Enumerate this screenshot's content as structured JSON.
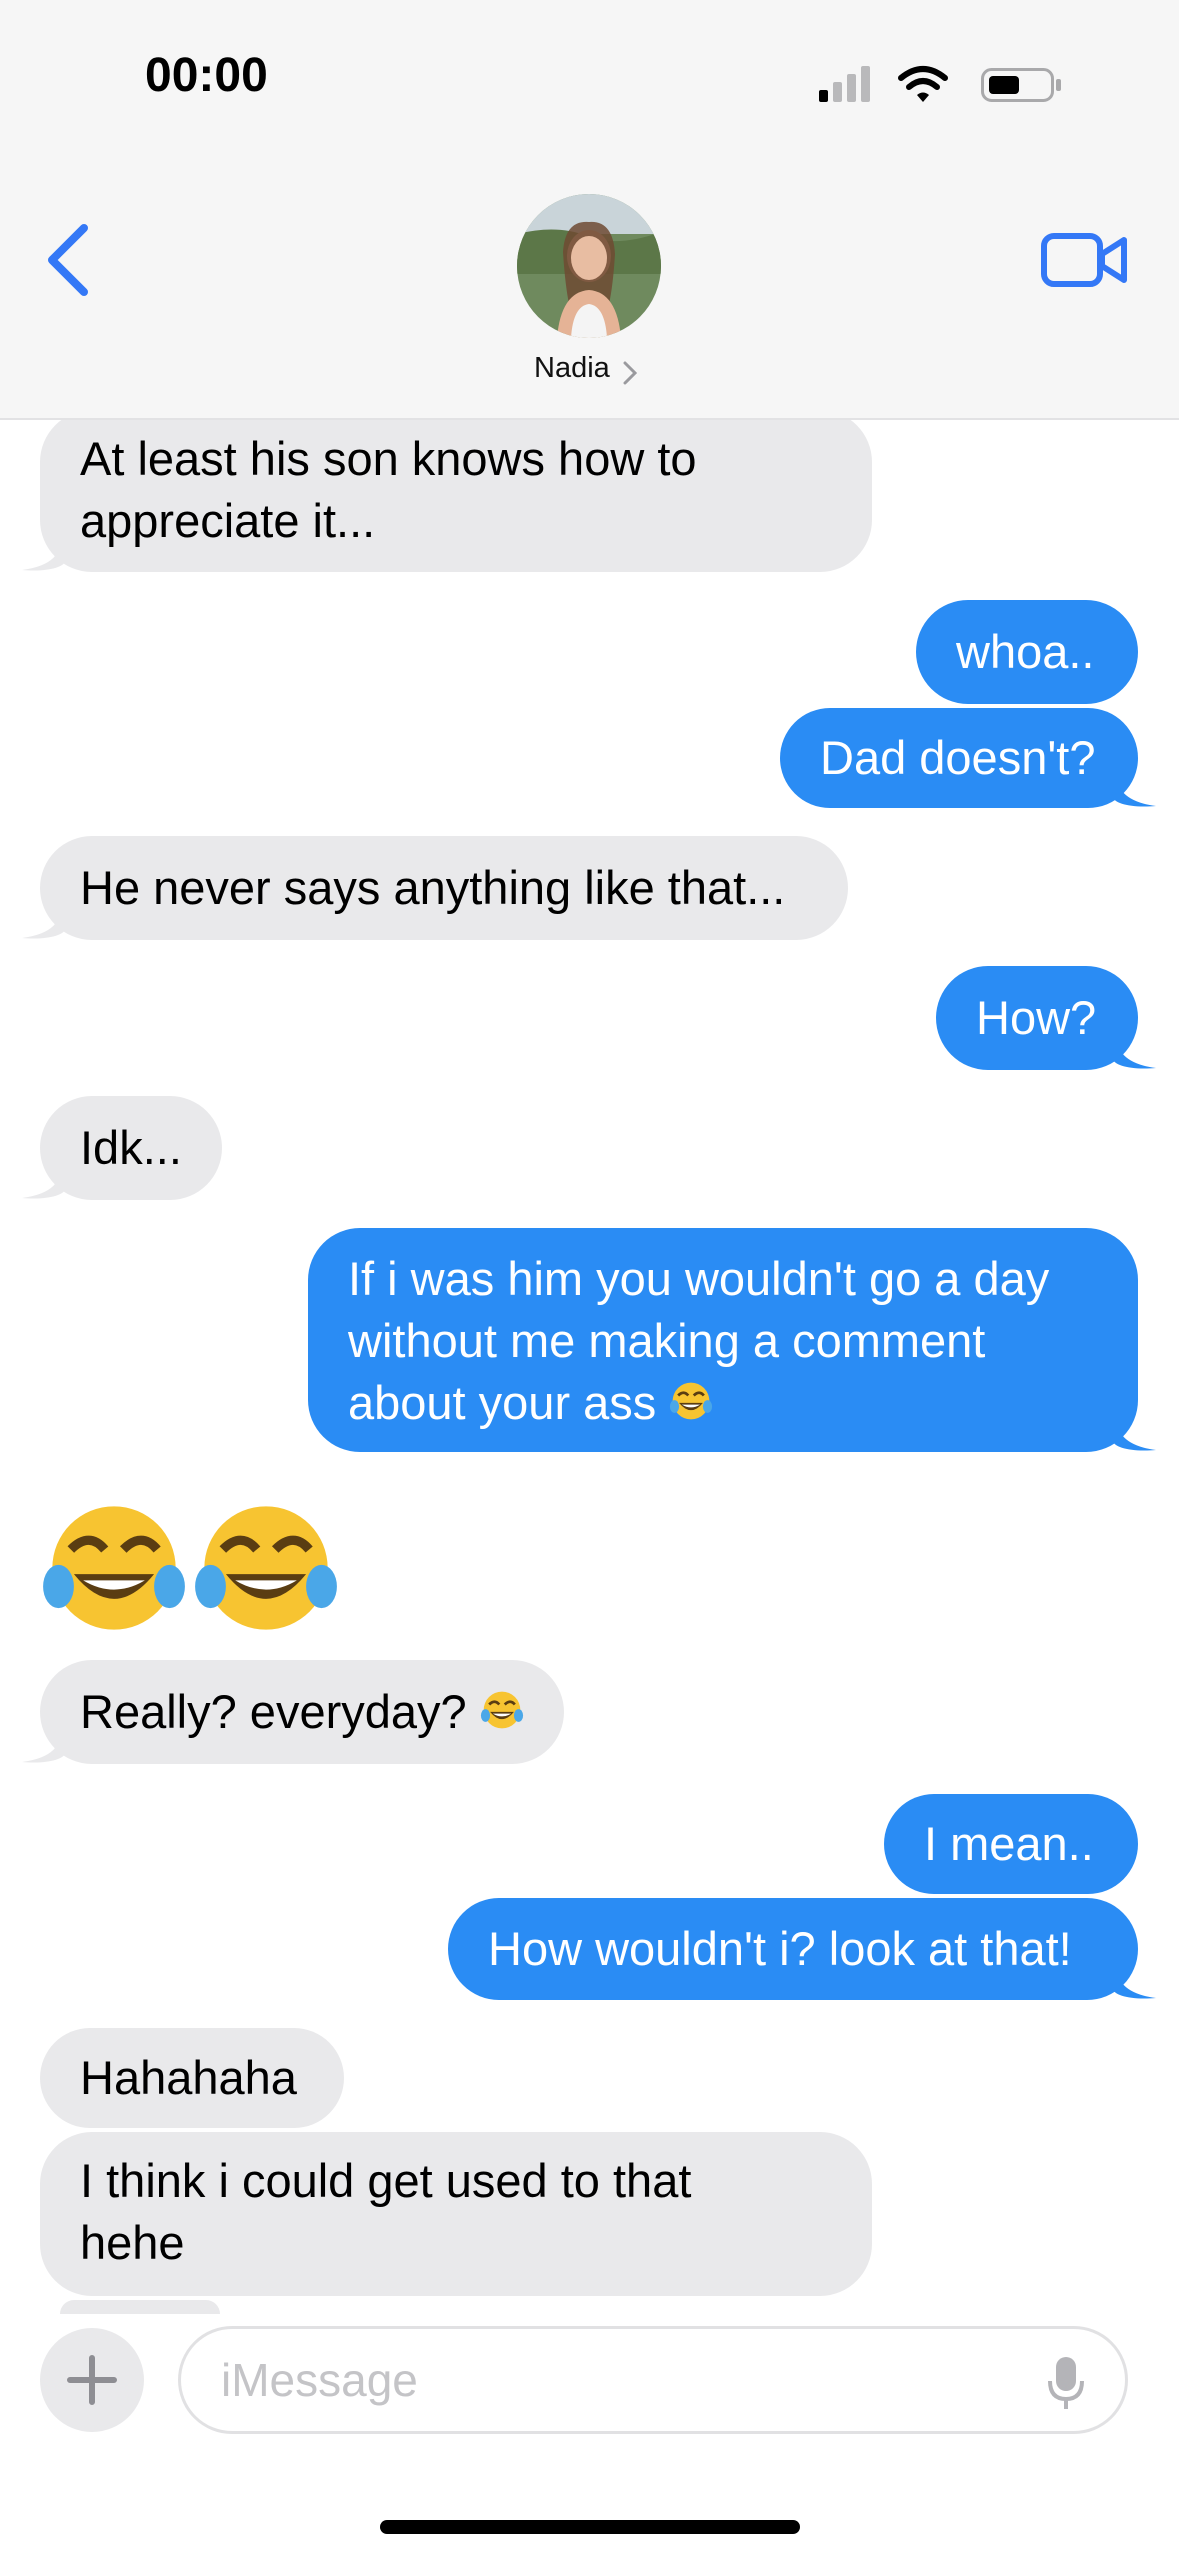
{
  "status_bar": {
    "time": "00:00",
    "icons": [
      "signal-icon",
      "wifi-icon",
      "battery-icon"
    ]
  },
  "header": {
    "contact_name": "Nadia",
    "back_icon": "chevron-left-icon",
    "video_icon": "video-camera-icon",
    "accent_color": "#3478f6"
  },
  "messages": [
    {
      "from": "contact",
      "text": "At least his son knows how to",
      "text2": "appreciate it..."
    },
    {
      "from": "me",
      "text": "whoa.."
    },
    {
      "from": "me",
      "text": "Dad doesn't?"
    },
    {
      "from": "contact",
      "text": "He never says anything like that..."
    },
    {
      "from": "me",
      "text": "How?"
    },
    {
      "from": "contact",
      "text": "Idk..."
    },
    {
      "from": "me",
      "text": "If i was him you wouldn't go a day",
      "text2": "without me making a comment",
      "text3": "about your ass",
      "emoji": "face-with-tears-of-joy"
    },
    {
      "from": "contact",
      "emoji_only": "😂😂"
    },
    {
      "from": "contact",
      "text": "Really? everyday?",
      "emoji": "face-with-tears-of-joy"
    },
    {
      "from": "me",
      "text": "I mean.."
    },
    {
      "from": "me",
      "text": "How wouldn't i? look at that!"
    },
    {
      "from": "contact",
      "text": "Hahahaha"
    },
    {
      "from": "contact",
      "text": "I think i could get used to that",
      "text2": "hehe"
    }
  ],
  "colors": {
    "sent_bubble": "#2a8cf4",
    "received_bubble": "#e9e9eb"
  },
  "input": {
    "placeholder": "iMessage",
    "plus_icon": "plus-icon",
    "mic_icon": "microphone-icon"
  }
}
